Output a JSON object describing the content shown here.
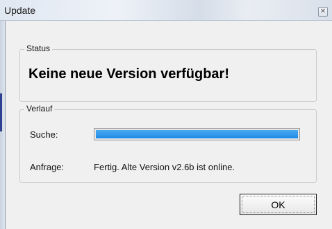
{
  "window": {
    "title": "Update",
    "close_glyph": "✕"
  },
  "status_group": {
    "label": "Status",
    "message": "Keine neue Version verfügbar!"
  },
  "verlauf_group": {
    "label": "Verlauf",
    "search_label": "Suche:",
    "search_progress_percent": 100,
    "request_label": "Anfrage:",
    "request_value": "Fertig. Alte Version v2.6b ist online."
  },
  "buttons": {
    "ok_label": "OK"
  },
  "colors": {
    "progress_fill": "#1f8be6",
    "window_background": "#f0f0f0"
  },
  "icons": {
    "close": "close-icon"
  }
}
